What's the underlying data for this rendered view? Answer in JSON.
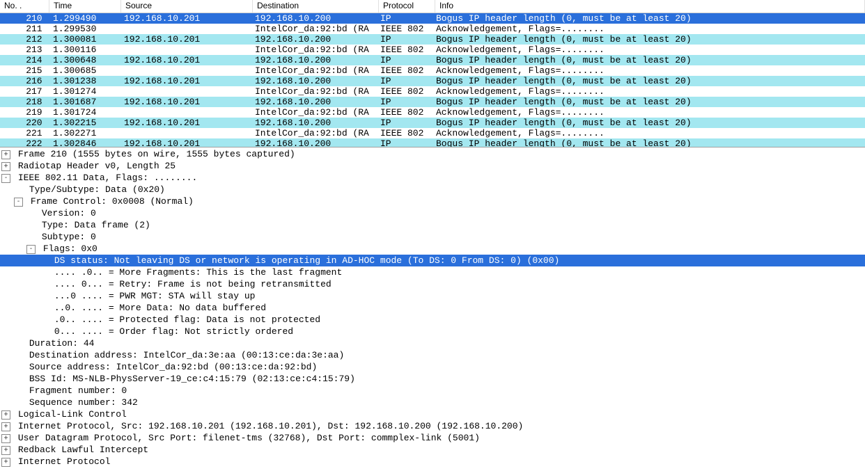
{
  "columns": {
    "no": "No. .",
    "time": "Time",
    "source": "Source",
    "destination": "Destination",
    "protocol": "Protocol",
    "info": "Info"
  },
  "packets": [
    {
      "no": "210",
      "time": "1.299490",
      "src": "192.168.10.201",
      "dst": "192.168.10.200",
      "proto": "IP",
      "info": "Bogus IP header length (0, must be at least 20)",
      "sel": true,
      "alt": true
    },
    {
      "no": "211",
      "time": "1.299530",
      "src": "",
      "dst": "IntelCor_da:92:bd (RA",
      "proto": "IEEE 802",
      "info": "Acknowledgement, Flags=........",
      "alt": false
    },
    {
      "no": "212",
      "time": "1.300081",
      "src": "192.168.10.201",
      "dst": "192.168.10.200",
      "proto": "IP",
      "info": "Bogus IP header length (0, must be at least 20)",
      "alt": true
    },
    {
      "no": "213",
      "time": "1.300116",
      "src": "",
      "dst": "IntelCor_da:92:bd (RA",
      "proto": "IEEE 802",
      "info": "Acknowledgement, Flags=........",
      "alt": false
    },
    {
      "no": "214",
      "time": "1.300648",
      "src": "192.168.10.201",
      "dst": "192.168.10.200",
      "proto": "IP",
      "info": "Bogus IP header length (0, must be at least 20)",
      "alt": true
    },
    {
      "no": "215",
      "time": "1.300685",
      "src": "",
      "dst": "IntelCor_da:92:bd (RA",
      "proto": "IEEE 802",
      "info": "Acknowledgement, Flags=........",
      "alt": false
    },
    {
      "no": "216",
      "time": "1.301238",
      "src": "192.168.10.201",
      "dst": "192.168.10.200",
      "proto": "IP",
      "info": "Bogus IP header length (0, must be at least 20)",
      "alt": true
    },
    {
      "no": "217",
      "time": "1.301274",
      "src": "",
      "dst": "IntelCor_da:92:bd (RA",
      "proto": "IEEE 802",
      "info": "Acknowledgement, Flags=........",
      "alt": false
    },
    {
      "no": "218",
      "time": "1.301687",
      "src": "192.168.10.201",
      "dst": "192.168.10.200",
      "proto": "IP",
      "info": "Bogus IP header length (0, must be at least 20)",
      "alt": true
    },
    {
      "no": "219",
      "time": "1.301724",
      "src": "",
      "dst": "IntelCor_da:92:bd (RA",
      "proto": "IEEE 802",
      "info": "Acknowledgement, Flags=........",
      "alt": false
    },
    {
      "no": "220",
      "time": "1.302215",
      "src": "192.168.10.201",
      "dst": "192.168.10.200",
      "proto": "IP",
      "info": "Bogus IP header length (0, must be at least 20)",
      "alt": true
    },
    {
      "no": "221",
      "time": "1.302271",
      "src": "",
      "dst": "IntelCor_da:92:bd (RA",
      "proto": "IEEE 802",
      "info": "Acknowledgement, Flags=........",
      "alt": false
    },
    {
      "no": "222",
      "time": "1.302846",
      "src": "192.168.10.201",
      "dst": "192.168.10.200",
      "proto": "IP",
      "info": "Bogus IP header length (0, must be at least 20)",
      "alt": true
    }
  ],
  "details": [
    {
      "indent": 0,
      "toggle": "+",
      "text": "Frame 210 (1555 bytes on wire, 1555 bytes captured)"
    },
    {
      "indent": 0,
      "toggle": "+",
      "text": "Radiotap Header v0, Length 25"
    },
    {
      "indent": 0,
      "toggle": "-",
      "text": "IEEE 802.11 Data, Flags: ........"
    },
    {
      "indent": 1,
      "toggle": "",
      "text": "Type/Subtype: Data (0x20)"
    },
    {
      "indent": 1,
      "toggle": "-",
      "text": "Frame Control: 0x0008 (Normal)"
    },
    {
      "indent": 2,
      "toggle": "",
      "text": "Version: 0"
    },
    {
      "indent": 2,
      "toggle": "",
      "text": "Type: Data frame (2)"
    },
    {
      "indent": 2,
      "toggle": "",
      "text": "Subtype: 0"
    },
    {
      "indent": 2,
      "toggle": "-",
      "text": "Flags: 0x0"
    },
    {
      "indent": 3,
      "toggle": "",
      "text": "DS status: Not leaving DS or network is operating in AD-HOC mode (To DS: 0 From DS: 0) (0x00)",
      "sel": true
    },
    {
      "indent": 3,
      "toggle": "",
      "text": ".... .0.. = More Fragments: This is the last fragment"
    },
    {
      "indent": 3,
      "toggle": "",
      "text": ".... 0... = Retry: Frame is not being retransmitted"
    },
    {
      "indent": 3,
      "toggle": "",
      "text": "...0 .... = PWR MGT: STA will stay up"
    },
    {
      "indent": 3,
      "toggle": "",
      "text": "..0. .... = More Data: No data buffered"
    },
    {
      "indent": 3,
      "toggle": "",
      "text": ".0.. .... = Protected flag: Data is not protected"
    },
    {
      "indent": 3,
      "toggle": "",
      "text": "0... .... = Order flag: Not strictly ordered"
    },
    {
      "indent": 1,
      "toggle": "",
      "text": "Duration: 44"
    },
    {
      "indent": 1,
      "toggle": "",
      "text": "Destination address: IntelCor_da:3e:aa (00:13:ce:da:3e:aa)"
    },
    {
      "indent": 1,
      "toggle": "",
      "text": "Source address: IntelCor_da:92:bd (00:13:ce:da:92:bd)"
    },
    {
      "indent": 1,
      "toggle": "",
      "text": "BSS Id: MS-NLB-PhysServer-19_ce:c4:15:79 (02:13:ce:c4:15:79)"
    },
    {
      "indent": 1,
      "toggle": "",
      "text": "Fragment number: 0"
    },
    {
      "indent": 1,
      "toggle": "",
      "text": "Sequence number: 342"
    },
    {
      "indent": 0,
      "toggle": "+",
      "text": "Logical-Link Control"
    },
    {
      "indent": 0,
      "toggle": "+",
      "text": "Internet Protocol, Src: 192.168.10.201 (192.168.10.201), Dst: 192.168.10.200 (192.168.10.200)"
    },
    {
      "indent": 0,
      "toggle": "+",
      "text": "User Datagram Protocol, Src Port: filenet-tms (32768), Dst Port: commplex-link (5001)"
    },
    {
      "indent": 0,
      "toggle": "+",
      "text": "Redback Lawful Intercept"
    },
    {
      "indent": 0,
      "toggle": "+",
      "text": "Internet Protocol"
    }
  ]
}
